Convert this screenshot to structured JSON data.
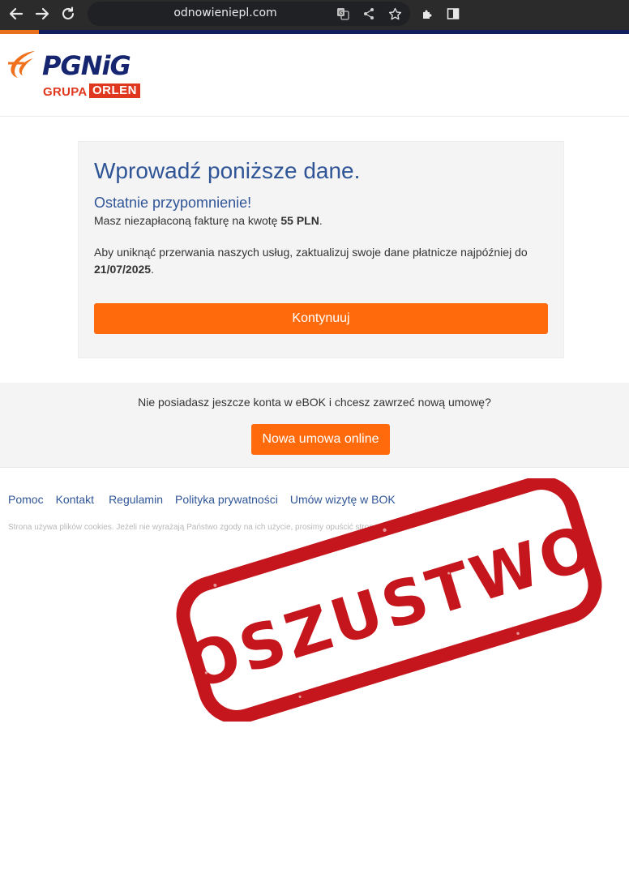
{
  "browser": {
    "url": "odnowieniepl.com",
    "icons": [
      "back-arrow-icon",
      "forward-arrow-icon",
      "reload-icon",
      "translate-icon",
      "share-icon",
      "bookmark-star-icon",
      "extensions-icon",
      "side-panel-icon"
    ]
  },
  "header": {
    "logo_word": "PGNiG",
    "logo_grupa": "GRUPA",
    "logo_orlen": "ORLEN"
  },
  "card": {
    "title": "Wprowadź poniższe dane.",
    "subtitle": "Ostatnie przypomnienie!",
    "invoice_text": "Masz niezapłaconą fakturę na kwotę ",
    "invoice_amount": "55 PLN",
    "invoice_end": ".",
    "update_text": "Aby uniknąć przerwania naszych usług, zaktualizuj swoje dane płatnicze najpóźniej do",
    "deadline": "21/07/2025",
    "deadline_end": ".",
    "continue_label": "Kontynuuj"
  },
  "signup": {
    "question": "Nie posiadasz jeszcze konta w eBOK i chcesz zawrzeć nową umowę?",
    "button_label": "Nowa umowa online"
  },
  "footer": {
    "links": [
      "Pomoc",
      "Kontakt",
      "Regulamin",
      "Polityka prywatności",
      "Umów wizytę w BOK"
    ],
    "cookie_text": "Strona używa plików cookies. Jeżeli nie wyrażają Państwo zgody na ich użycie, prosimy opuścić stronę."
  },
  "stamp": {
    "text": "OSZUSTWO",
    "color": "#c4161c"
  },
  "colors": {
    "accent_orange": "#ff6b0c",
    "title_blue": "#2f5597",
    "brand_navy": "#15256f",
    "brand_red": "#e0381e"
  }
}
